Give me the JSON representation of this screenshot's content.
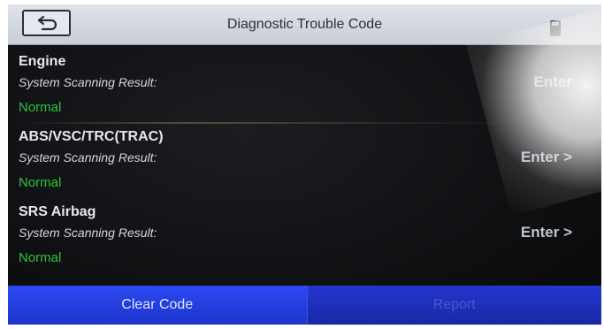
{
  "header": {
    "title": "Diagnostic Trouble Code",
    "back_icon": "back-arrow-icon",
    "battery_icon": "battery-icon"
  },
  "systems": [
    {
      "name": "Engine",
      "sub_label": "System Scanning Result:",
      "status": "Normal",
      "action": "Enter"
    },
    {
      "name": "ABS/VSC/TRC(TRAC)",
      "sub_label": "System Scanning Result:",
      "status": "Normal",
      "action": "Enter >"
    },
    {
      "name": "SRS Airbag",
      "sub_label": "System Scanning Result:",
      "status": "Normal",
      "action": "Enter >"
    }
  ],
  "footer": {
    "clear_label": "Clear Code",
    "report_label": "Report"
  },
  "colors": {
    "header_bg": "#d3d8e0",
    "status_green": "#2fc33a",
    "button_blue": "#2a46f0",
    "screen_bg": "#111316"
  }
}
